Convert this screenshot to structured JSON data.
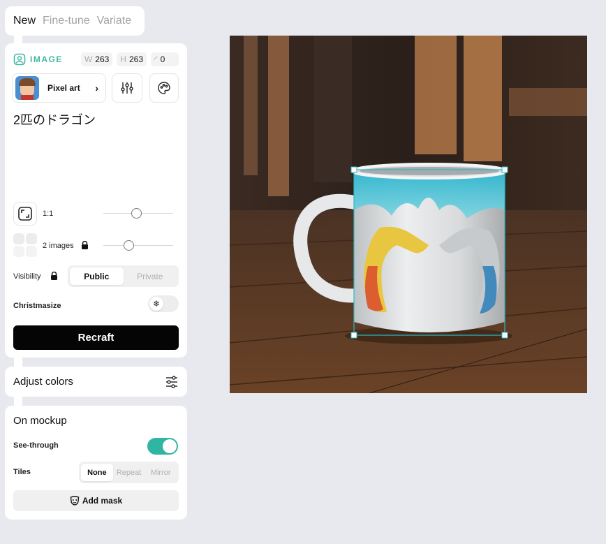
{
  "tabs": {
    "new": "New",
    "fine_tune": "Fine-tune",
    "variate": "Variate"
  },
  "image_section": {
    "label": "IMAGE",
    "width_key": "W",
    "width": "263",
    "height_key": "H",
    "height": "263",
    "rotation": "0",
    "style_name": "Pixel art",
    "prompt": "2匹のドラゴン"
  },
  "aspect": {
    "label": "1:1",
    "slider_value": 0.5
  },
  "images_count": {
    "label": "2 images",
    "slider_value": 0.35
  },
  "visibility": {
    "label": "Visibility",
    "options": [
      "Public",
      "Private"
    ],
    "selected": "Public"
  },
  "christmasize": {
    "label": "Christmasize"
  },
  "recraft_button": "Recraft",
  "adjust_colors": {
    "label": "Adjust colors"
  },
  "mockup": {
    "title": "On mockup",
    "see_through": {
      "label": "See-through",
      "on": true
    },
    "tiles": {
      "label": "Tiles",
      "options": [
        "None",
        "Repeat",
        "Mirror"
      ],
      "selected": "None"
    },
    "add_mask": "Add mask"
  },
  "colors": {
    "accent": "#3fb9a3",
    "toggle_on": "#2fb5a1",
    "selection": "#2eb8c4"
  },
  "icons": [
    "image-icon",
    "chevron-right-icon",
    "sliders-icon",
    "palette-icon",
    "crop-frame-icon",
    "grid-icon",
    "lock-icon",
    "snowflake-icon",
    "adjust-sliders-icon",
    "mask-icon"
  ]
}
